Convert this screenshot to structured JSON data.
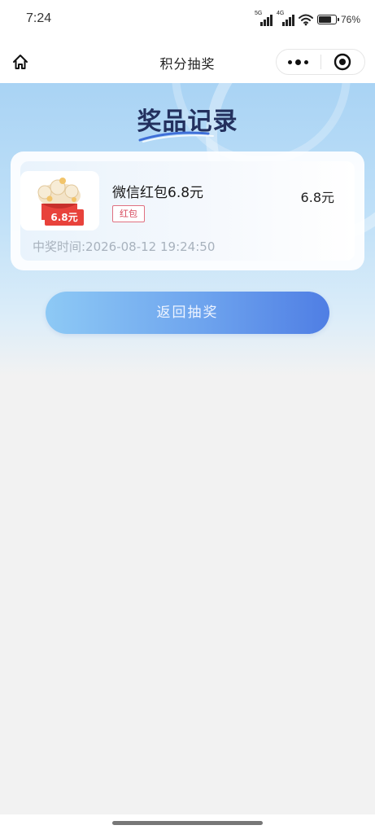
{
  "status_bar": {
    "time": "7:24",
    "network_5g": "5G",
    "network_4g": "4G",
    "battery_percent": "76%",
    "battery_level": 0.76
  },
  "nav": {
    "title": "积分抽奖",
    "home_icon": "home-icon",
    "more_icon": "more-dots-icon",
    "close_icon": "target-close-icon"
  },
  "hero": {
    "title": "奖品记录"
  },
  "record": {
    "thumb_label": "6.8元",
    "prize_name": "微信红包6.8元",
    "amount": "6.8元",
    "tag": "红包",
    "win_time": "中奖时间:2026-08-12  19:24:50"
  },
  "actions": {
    "back_label": "返回抽奖"
  },
  "colors": {
    "title_navy": "#23305e",
    "tag_red": "#d64b5e",
    "button_start": "#8dc9f5",
    "button_end": "#4f7ee4"
  }
}
